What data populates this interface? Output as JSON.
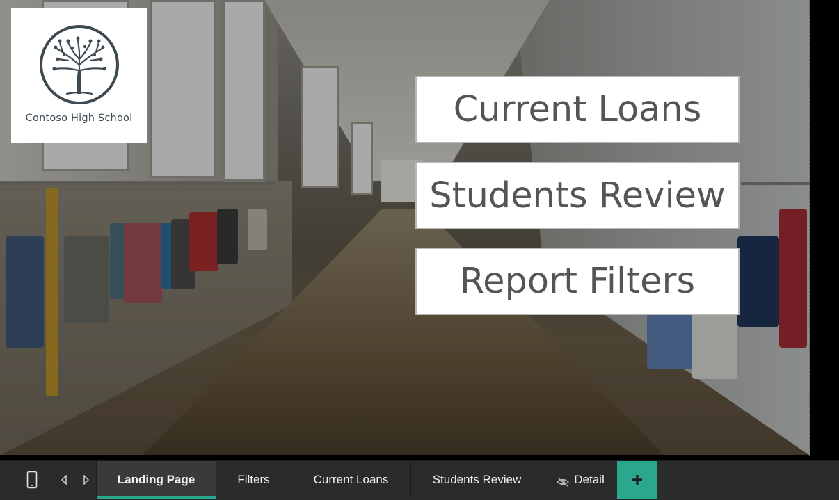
{
  "logo": {
    "school_name": "Contoso High School"
  },
  "nav_buttons": {
    "current_loans": "Current Loans",
    "students_review": "Students Review",
    "report_filters": "Report Filters"
  },
  "page_tabs": [
    {
      "label": "Landing Page",
      "active": true
    },
    {
      "label": "Filters"
    },
    {
      "label": "Current Loans"
    },
    {
      "label": "Students Review"
    },
    {
      "label": "Detail",
      "hidden_icon": "eye-slash-icon"
    }
  ],
  "tabbar_controls": {
    "mobile_icon": "mobile-layout-icon",
    "prev_icon": "chevron-left-icon",
    "next_icon": "chevron-right-icon",
    "add_icon": "plus-icon"
  },
  "colors": {
    "accent": "#2ba78e",
    "tabbar_bg": "#2b2b2b",
    "button_text": "#555555",
    "logo_text": "#3e4a52"
  }
}
